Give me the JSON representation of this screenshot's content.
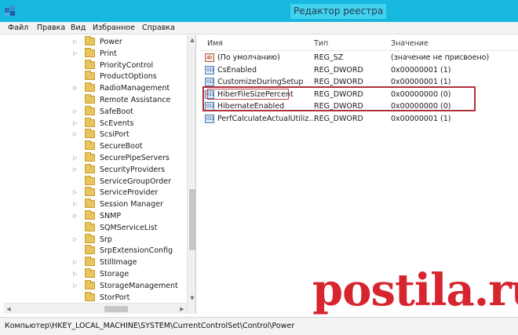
{
  "window": {
    "title": "Редактор реестра",
    "app_icon": "regedit-icon"
  },
  "menu": [
    "Файл",
    "Правка",
    "Вид",
    "Избранное",
    "Справка"
  ],
  "tree": {
    "items": [
      "Power",
      "Print",
      "PriorityControl",
      "ProductOptions",
      "RadioManagement",
      "Remote Assistance",
      "SafeBoot",
      "ScEvents",
      "ScsiPort",
      "SecureBoot",
      "SecurePipeServers",
      "SecurityProviders",
      "ServiceGroupOrder",
      "ServiceProvider",
      "Session Manager",
      "SNMP",
      "SQMServiceList",
      "Srp",
      "SrpExtensionConfig",
      "StillImage",
      "Storage",
      "StorageManagement",
      "StorPort"
    ],
    "expandable": [
      true,
      true,
      false,
      false,
      true,
      false,
      true,
      true,
      true,
      false,
      true,
      true,
      false,
      true,
      true,
      true,
      false,
      true,
      false,
      true,
      true,
      true,
      false
    ]
  },
  "list": {
    "columns": [
      "Имя",
      "Тип",
      "Значение"
    ],
    "rows": [
      {
        "icon": "ab-string-icon",
        "name": "(По умолчанию)",
        "type": "REG_SZ",
        "data": "(значение не присвоено)"
      },
      {
        "icon": "dword-icon",
        "name": "CsEnabled",
        "type": "REG_DWORD",
        "data": "0x00000001 (1)"
      },
      {
        "icon": "dword-icon",
        "name": "CustomizeDuringSetup",
        "type": "REG_DWORD",
        "data": "0x00000001 (1)"
      },
      {
        "icon": "dword-icon",
        "name": "HiberFileSizePercent",
        "type": "REG_DWORD",
        "data": "0x00000000 (0)"
      },
      {
        "icon": "dword-icon",
        "name": "HibernateEnabled",
        "type": "REG_DWORD",
        "data": "0x00000000 (0)"
      },
      {
        "icon": "dword-icon",
        "name": "PerfCalculateActualUtiliz...",
        "type": "REG_DWORD",
        "data": "0x00000001 (1)"
      }
    ]
  },
  "statusbar": {
    "path": "Компьютер\\HKEY_LOCAL_MACHINE\\SYSTEM\\CurrentControlSet\\Control\\Power"
  },
  "watermark": {
    "text": "postila.ru"
  },
  "colors": {
    "titlebar": "#17b8df",
    "highlight_box": "#b0313b",
    "watermark": "#d6252f",
    "folder": "#e9c55f"
  }
}
